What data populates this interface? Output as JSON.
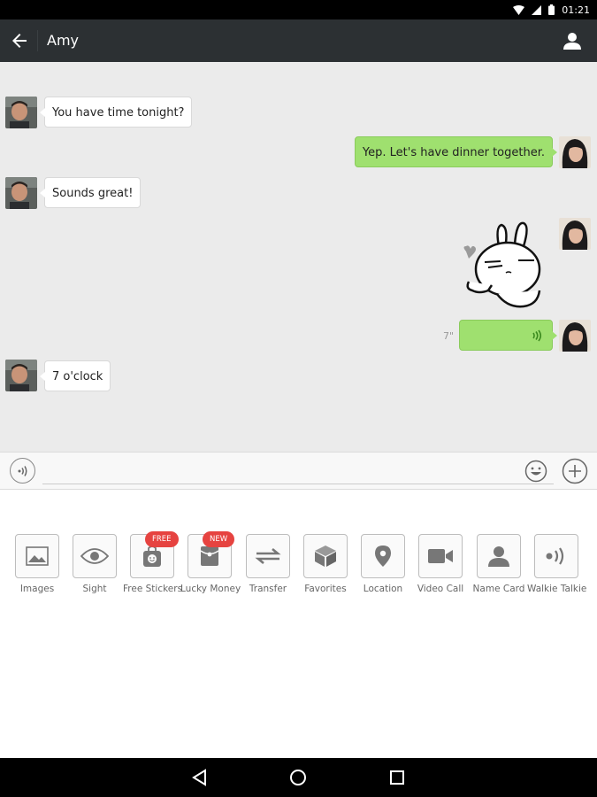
{
  "status_bar": {
    "time": "01:21"
  },
  "header": {
    "title": "Amy"
  },
  "messages": [
    {
      "side": "in",
      "text": "You have time tonight?"
    },
    {
      "side": "out",
      "text": "Yep. Let's have dinner together."
    },
    {
      "side": "in",
      "text": "Sounds great!"
    },
    {
      "side": "out",
      "type": "sticker"
    },
    {
      "side": "out",
      "type": "voice",
      "duration": "7\""
    },
    {
      "side": "in",
      "text": "7 o'clock"
    }
  ],
  "input": {
    "value": "",
    "placeholder": ""
  },
  "tools": [
    {
      "label": "Images",
      "icon": "image-icon"
    },
    {
      "label": "Sight",
      "icon": "eye-icon"
    },
    {
      "label": "Free Stickers",
      "icon": "sticker-bag-icon",
      "badge": "FREE"
    },
    {
      "label": "Lucky Money",
      "icon": "red-packet-icon",
      "badge": "NEW"
    },
    {
      "label": "Transfer",
      "icon": "transfer-arrows-icon"
    },
    {
      "label": "Favorites",
      "icon": "cube-icon"
    },
    {
      "label": "Location",
      "icon": "location-pin-icon"
    },
    {
      "label": "Video Call",
      "icon": "video-camera-icon"
    },
    {
      "label": "Name Card",
      "icon": "person-icon"
    },
    {
      "label": "Walkie Talkie",
      "icon": "walkie-talkie-icon"
    }
  ],
  "colors": {
    "header_bg": "#2c3033",
    "chat_bg": "#ebebeb",
    "outgoing_bubble": "#9fe06f",
    "badge_red": "#e64340"
  }
}
